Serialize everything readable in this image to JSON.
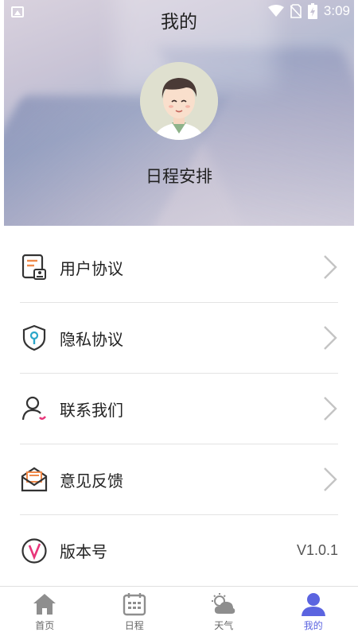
{
  "status_bar": {
    "time": "3:09"
  },
  "header": {
    "title": "我的",
    "username": "日程安排"
  },
  "menu": {
    "items": [
      {
        "label": "用户协议",
        "icon": "user-agreement-icon"
      },
      {
        "label": "隐私协议",
        "icon": "privacy-shield-icon"
      },
      {
        "label": "联系我们",
        "icon": "contact-person-icon"
      },
      {
        "label": "意见反馈",
        "icon": "feedback-mail-icon"
      }
    ],
    "version": {
      "label": "版本号",
      "value": "V1.0.1",
      "icon": "version-v-icon"
    }
  },
  "bottom_nav": {
    "items": [
      {
        "label": "首页",
        "icon": "home-icon"
      },
      {
        "label": "日程",
        "icon": "calendar-icon"
      },
      {
        "label": "天气",
        "icon": "weather-icon"
      },
      {
        "label": "我的",
        "icon": "profile-icon"
      }
    ],
    "active_index": 3
  },
  "colors": {
    "accent": "#5b64e0",
    "icon_orange": "#f08a4b",
    "icon_pink": "#e8357a",
    "icon_teal": "#2aa6c9"
  }
}
